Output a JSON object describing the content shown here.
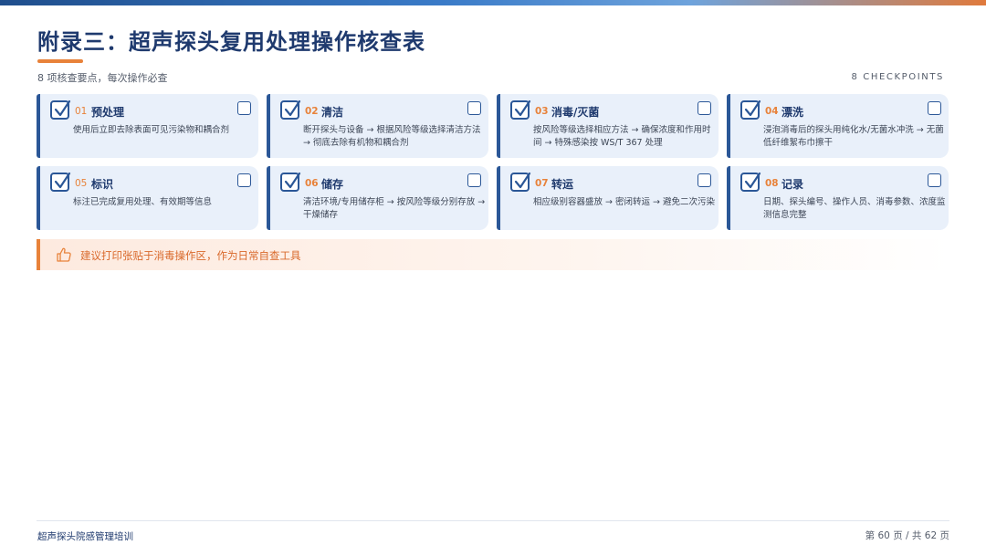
{
  "header": {
    "title": "附录三：超声探头复用处理操作核查表",
    "subtitle": "8 项核查要点，每次操作必查",
    "count_label": "8 CHECKPOINTS"
  },
  "checklist": [
    {
      "num": "01",
      "label": "预处理",
      "desc": "使用后立即去除表面可见污染物和耦合剂"
    },
    {
      "num": "02",
      "label": "清洁",
      "desc": "断开探头与设备 → 根据风险等级选择清洁方法 → 彻底去除有机物和耦合剂"
    },
    {
      "num": "03",
      "label": "消毒/灭菌",
      "desc": "按风险等级选择相应方法 → 确保浓度和作用时间 → 特殊感染按 WS/T 367 处理"
    },
    {
      "num": "04",
      "label": "漂洗",
      "desc": "浸泡消毒后的探头用纯化水/无菌水冲洗 → 无菌低纤维絮布巾擦干"
    },
    {
      "num": "05",
      "label": "标识",
      "desc": "标注已完成复用处理、有效期等信息"
    },
    {
      "num": "06",
      "label": "储存",
      "desc": "清洁环境/专用储存柜 → 按风险等级分别存放 → 干燥储存"
    },
    {
      "num": "07",
      "label": "转运",
      "desc": "相应级别容器盛放 → 密闭转运 → 避免二次污染"
    },
    {
      "num": "08",
      "label": "记录",
      "desc": "日期、探头编号、操作人员、消毒参数、浓度监测信息完整"
    }
  ],
  "tip": {
    "text": "建议打印张贴于消毒操作区，作为日常自查工具"
  },
  "footer": {
    "course": "超声探头院感管理培训",
    "page_prefix": "第",
    "page_current": "60",
    "page_mid": "页 / 共",
    "page_total": "62",
    "page_suffix": "页"
  },
  "colors": {
    "accent_orange": "#e8823a",
    "navy": "#1f3a6e",
    "card_bg": "#e9f0fa"
  }
}
